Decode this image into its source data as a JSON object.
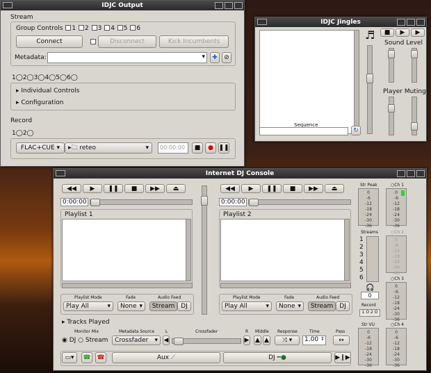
{
  "output": {
    "title": "IDJC Output",
    "stream": "Stream",
    "group_controls": "Group Controls",
    "groups": [
      "1",
      "2",
      "3",
      "4",
      "5",
      "6"
    ],
    "connect": "Connect",
    "disconnect": "Disconnect",
    "kick": "Kick Incumbents",
    "metadata": "Metadata:",
    "tabs": [
      "1",
      "2",
      "3",
      "4",
      "5",
      "6"
    ],
    "individual": "Individual Controls",
    "configuration": "Configuration",
    "record": "Record",
    "rec_tabs": [
      "1",
      "2"
    ],
    "format": "FLAC+CUE",
    "folder": "reteo",
    "time": "00:00:00"
  },
  "jingles": {
    "title": "IDJC Jingles",
    "sequence": "Sequence",
    "sound_level": "Sound Level",
    "player_muting": "Player Muting"
  },
  "console": {
    "title": "Internet DJ Console",
    "time1": "0:00:00",
    "time2": "0:00:00",
    "playlist1": "Playlist 1",
    "playlist2": "Playlist 2",
    "playlist_mode": "Playlist Mode",
    "fade": "Fade",
    "audio_feed": "Audio Feed",
    "mode_val": "Play All",
    "fade_val": "None",
    "stream_btn": "Stream",
    "dj_btn": "DJ",
    "tracks_played": "Tracks Played",
    "monitor_mix": "Monitor Mix",
    "mm_dj": "DJ",
    "mm_stream": "Stream",
    "metadata_source": "Metadata Source",
    "ms_val": "Crossfader",
    "l": "L",
    "crossfader": "Crossfader",
    "r": "R",
    "middle": "Middle",
    "response": "Response",
    "time": "Time",
    "time_val": "1.00",
    "pass": "Pass",
    "aux": "Aux",
    "dj": "DJ",
    "str_peak": "Str Peak",
    "streams": "Streams",
    "stream_nums": [
      "1",
      "2",
      "3",
      "4",
      "5",
      "6"
    ],
    "listeners": "0",
    "record": "Record",
    "rec_nums": "1 O 2 O",
    "str_vu": "Str VU",
    "ch1": "Ch 1",
    "ch2": "Ch 2",
    "ch3": "Ch 3",
    "ch4": "Ch 4",
    "scale": [
      "0",
      "-6",
      "-12",
      "-18",
      "-24",
      "-30",
      "-36"
    ]
  }
}
